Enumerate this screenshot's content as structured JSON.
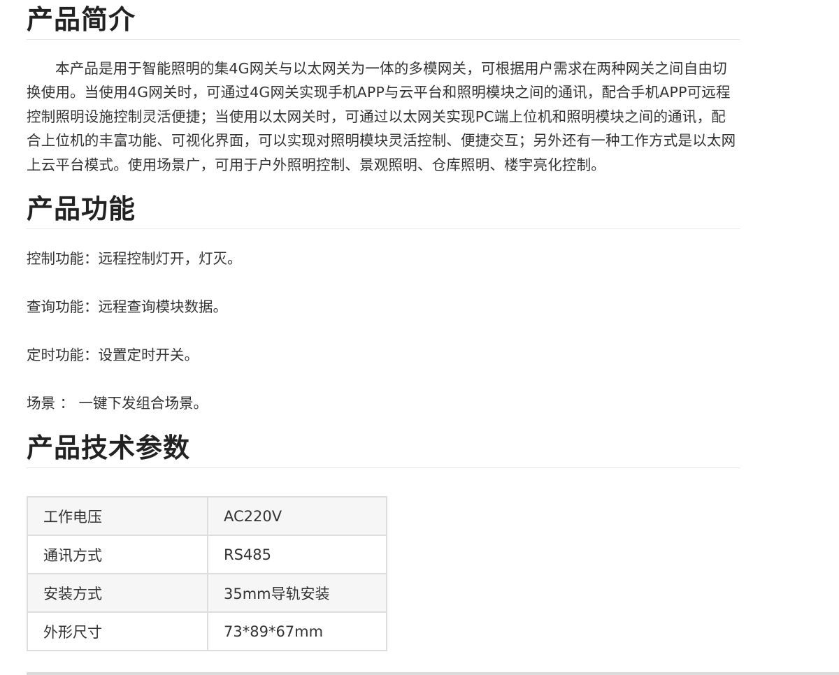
{
  "intro": {
    "title": "产品简介",
    "text": "本产品是用于智能照明的集4G网关与以太网关为一体的多模网关，可根据用户需求在两种网关之间自由切换使用。当使用4G网关时，可通过4G网关实现手机APP与云平台和照明模块之间的通讯，配合手机APP可远程控制照明设施控制灵活便捷；当使用以太网关时，可通过以太网关实现PC端上位机和照明模块之间的通讯，配合上位机的丰富功能、可视化界面，可以实现对照明模块灵活控制、便捷交互；另外还有一种工作方式是以太网上云平台模式。使用场景广，可用于户外照明控制、景观照明、仓库照明、楼宇亮化控制。"
  },
  "functions": {
    "title": "产品功能",
    "items": [
      "控制功能：远程控制灯开，灯灭。",
      "查询功能：远程查询模块数据。",
      "定时功能：设置定时开关。",
      "场景 ： 一键下发组合场景。"
    ]
  },
  "specs": {
    "title": "产品技术参数",
    "rows": [
      {
        "key": "工作电压",
        "value": "AC220V"
      },
      {
        "key": "通讯方式",
        "value": "RS485"
      },
      {
        "key": "安装方式",
        "value": "35mm导轨安装"
      },
      {
        "key": "外形尺寸",
        "value": "73*89*67mm"
      }
    ]
  }
}
